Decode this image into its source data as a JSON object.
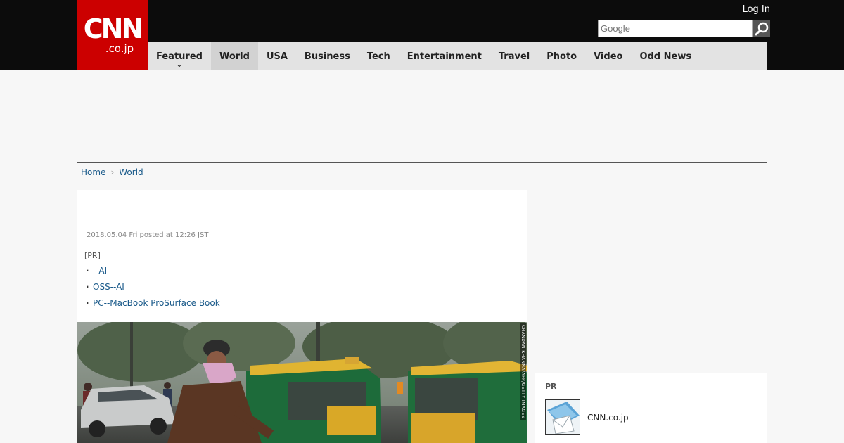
{
  "header": {
    "logo_main": "CNN",
    "logo_sub": ".co.jp",
    "login_label": "Log In",
    "search_placeholder": "Google",
    "brand_color": "#cc0000"
  },
  "nav": {
    "items": [
      {
        "label": "Featured"
      },
      {
        "label": "World"
      },
      {
        "label": "USA"
      },
      {
        "label": "Business"
      },
      {
        "label": "Tech"
      },
      {
        "label": "Entertainment"
      },
      {
        "label": "Travel"
      },
      {
        "label": "Photo"
      },
      {
        "label": "Video"
      },
      {
        "label": "Odd News"
      }
    ],
    "active": "World"
  },
  "breadcrumb": {
    "home": "Home",
    "current": "World"
  },
  "article": {
    "dateline": "2018.05.04 Fri posted at 12:26 JST",
    "pr_label": "[PR]",
    "pr_links": [
      "--AI",
      "OSS--AI",
      "PC--MacBook ProSurface Book"
    ],
    "photo_credit": "CHANDAN KHANNA/AFP/GETTY IMAGES"
  },
  "sidebar": {
    "pr_label": "PR",
    "item_text": "CNN.co.jp"
  },
  "icons": {
    "search": "magnifier-icon",
    "caret": "chevron-down-icon",
    "breadcrumb_sep": "chevron-right-icon"
  }
}
